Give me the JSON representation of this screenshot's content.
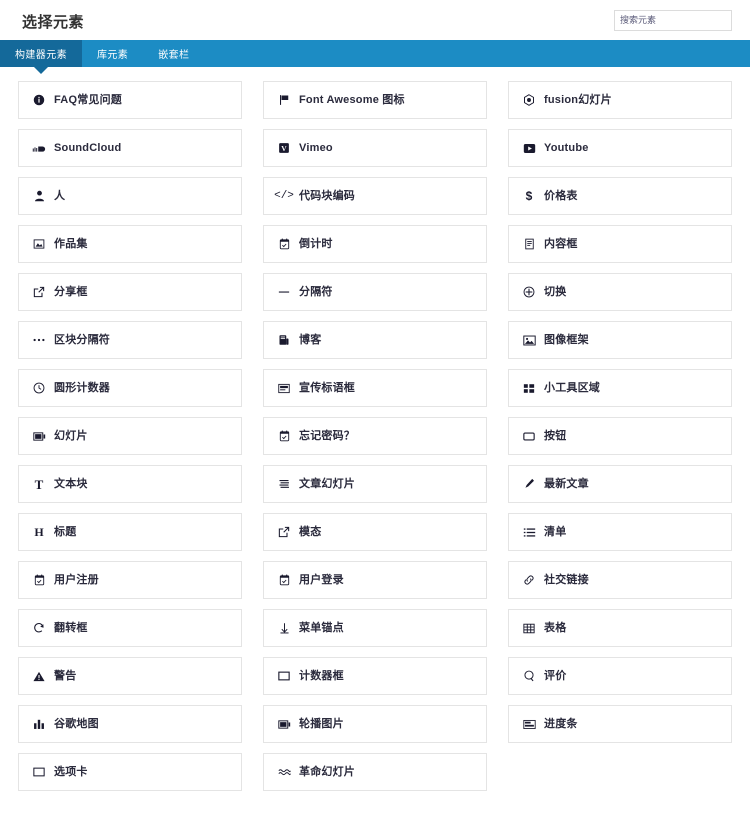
{
  "header": {
    "title": "选择元素",
    "search": {
      "placeholder": "搜索元素",
      "value": ""
    }
  },
  "tabs": [
    {
      "label": "构建器元素",
      "active": true
    },
    {
      "label": "库元素",
      "active": false
    },
    {
      "label": "嵌套栏",
      "active": false
    }
  ],
  "colors": {
    "tabbar_bg": "#1c8cc4",
    "tab_active_bg": "#14699a",
    "card_border": "#e4e4e4",
    "text": "#2b2b3d",
    "page_bg": "#ffffff"
  },
  "elements": [
    {
      "label": "FAQ常见问题",
      "icon": "info-circle-icon"
    },
    {
      "label": "Font Awesome 图标",
      "icon": "flag-icon"
    },
    {
      "label": "fusion幻灯片",
      "icon": "gem-icon"
    },
    {
      "label": "SoundCloud",
      "icon": "soundcloud-icon"
    },
    {
      "label": "Vimeo",
      "icon": "vimeo-icon"
    },
    {
      "label": "Youtube",
      "icon": "youtube-icon"
    },
    {
      "label": "人",
      "icon": "person-icon"
    },
    {
      "label": "代码块编码",
      "icon": "code-icon"
    },
    {
      "label": "价格表",
      "icon": "dollar-icon"
    },
    {
      "label": "作品集",
      "icon": "portfolio-icon"
    },
    {
      "label": "倒计时",
      "icon": "calendar-check-icon"
    },
    {
      "label": "内容框",
      "icon": "content-box-icon"
    },
    {
      "label": "分享框",
      "icon": "share-box-icon"
    },
    {
      "label": "分隔符",
      "icon": "minus-icon"
    },
    {
      "label": "切换",
      "icon": "toggle-icon"
    },
    {
      "label": "区块分隔符",
      "icon": "ellipsis-icon"
    },
    {
      "label": "博客",
      "icon": "blog-icon"
    },
    {
      "label": "图像框架",
      "icon": "image-frame-icon"
    },
    {
      "label": "圆形计数器",
      "icon": "clock-icon"
    },
    {
      "label": "宣传标语框",
      "icon": "tagline-box-icon"
    },
    {
      "label": "小工具区域",
      "icon": "widget-area-icon"
    },
    {
      "label": "幻灯片",
      "icon": "slider-icon"
    },
    {
      "label": "忘记密码？",
      "icon": "calendar-check-icon"
    },
    {
      "label": "按钮",
      "icon": "button-icon"
    },
    {
      "label": "文本块",
      "icon": "text-block-icon"
    },
    {
      "label": "文章幻灯片",
      "icon": "post-slider-icon"
    },
    {
      "label": "最新文章",
      "icon": "pen-icon"
    },
    {
      "label": "标题",
      "icon": "heading-icon"
    },
    {
      "label": "模态",
      "icon": "modal-icon"
    },
    {
      "label": "清单",
      "icon": "checklist-icon"
    },
    {
      "label": "用户注册",
      "icon": "calendar-check-icon"
    },
    {
      "label": "用户登录",
      "icon": "calendar-check-icon"
    },
    {
      "label": "社交链接",
      "icon": "link-icon"
    },
    {
      "label": "翻转框",
      "icon": "flip-box-icon"
    },
    {
      "label": "菜单锚点",
      "icon": "anchor-icon"
    },
    {
      "label": "表格",
      "icon": "table-icon"
    },
    {
      "label": "警告",
      "icon": "warning-icon"
    },
    {
      "label": "计数器框",
      "icon": "counter-box-icon"
    },
    {
      "label": "评价",
      "icon": "testimonial-icon"
    },
    {
      "label": "谷歌地图",
      "icon": "map-icon"
    },
    {
      "label": "轮播图片",
      "icon": "carousel-icon"
    },
    {
      "label": "进度条",
      "icon": "progress-bar-icon"
    },
    {
      "label": "选项卡",
      "icon": "tabs-icon"
    },
    {
      "label": "革命幻灯片",
      "icon": "revolution-slider-icon"
    }
  ]
}
